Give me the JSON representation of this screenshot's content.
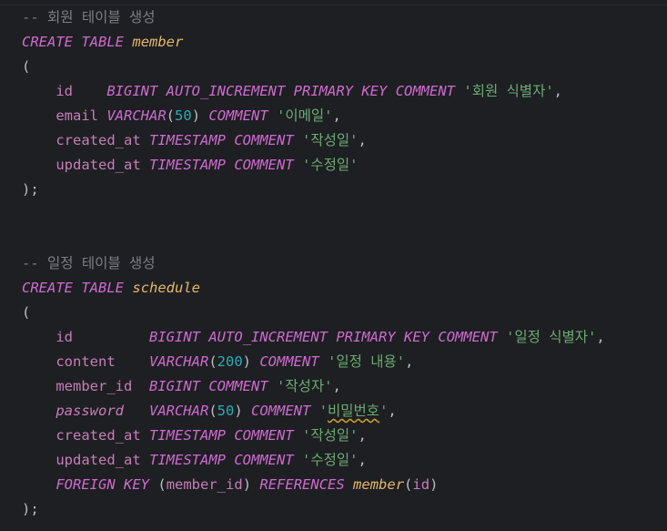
{
  "editor": {
    "lines": [
      [
        {
          "t": "-- 회원 테이블 생성",
          "c": "comment"
        }
      ],
      [
        {
          "t": "CREATE",
          "c": "kw"
        },
        {
          "t": " ",
          "c": "ws"
        },
        {
          "t": "TABLE",
          "c": "kw"
        },
        {
          "t": " ",
          "c": "ws"
        },
        {
          "t": "member",
          "c": "name"
        }
      ],
      [
        {
          "t": "(",
          "c": "paren"
        }
      ],
      [
        {
          "t": "    ",
          "c": "ws"
        },
        {
          "t": "id",
          "c": "field"
        },
        {
          "t": "    ",
          "c": "ws"
        },
        {
          "t": "BIGINT",
          "c": "kw"
        },
        {
          "t": " ",
          "c": "ws"
        },
        {
          "t": "AUTO_INCREMENT",
          "c": "kw"
        },
        {
          "t": " ",
          "c": "ws"
        },
        {
          "t": "PRIMARY",
          "c": "kw"
        },
        {
          "t": " ",
          "c": "ws"
        },
        {
          "t": "KEY",
          "c": "kw"
        },
        {
          "t": " ",
          "c": "ws"
        },
        {
          "t": "COMMENT",
          "c": "kw"
        },
        {
          "t": " ",
          "c": "ws"
        },
        {
          "t": "'회원 식별자'",
          "c": "str"
        },
        {
          "t": ",",
          "c": "punct"
        }
      ],
      [
        {
          "t": "    ",
          "c": "ws"
        },
        {
          "t": "email",
          "c": "field"
        },
        {
          "t": " ",
          "c": "ws"
        },
        {
          "t": "VARCHAR",
          "c": "kw"
        },
        {
          "t": "(",
          "c": "paren"
        },
        {
          "t": "50",
          "c": "num"
        },
        {
          "t": ")",
          "c": "paren"
        },
        {
          "t": " ",
          "c": "ws"
        },
        {
          "t": "COMMENT",
          "c": "kw"
        },
        {
          "t": " ",
          "c": "ws"
        },
        {
          "t": "'이메일'",
          "c": "str"
        },
        {
          "t": ",",
          "c": "punct"
        }
      ],
      [
        {
          "t": "    ",
          "c": "ws"
        },
        {
          "t": "created_at",
          "c": "field"
        },
        {
          "t": " ",
          "c": "ws"
        },
        {
          "t": "TIMESTAMP",
          "c": "kw"
        },
        {
          "t": " ",
          "c": "ws"
        },
        {
          "t": "COMMENT",
          "c": "kw"
        },
        {
          "t": " ",
          "c": "ws"
        },
        {
          "t": "'작성일'",
          "c": "str"
        },
        {
          "t": ",",
          "c": "punct"
        }
      ],
      [
        {
          "t": "    ",
          "c": "ws"
        },
        {
          "t": "updated_at",
          "c": "field"
        },
        {
          "t": " ",
          "c": "ws"
        },
        {
          "t": "TIMESTAMP",
          "c": "kw"
        },
        {
          "t": " ",
          "c": "ws"
        },
        {
          "t": "COMMENT",
          "c": "kw"
        },
        {
          "t": " ",
          "c": "ws"
        },
        {
          "t": "'수정일'",
          "c": "str"
        }
      ],
      [
        {
          "t": ");",
          "c": "punct"
        }
      ],
      [],
      [],
      [
        {
          "t": "-- 일정 테이블 생성",
          "c": "comment"
        }
      ],
      [
        {
          "t": "CREATE",
          "c": "kw"
        },
        {
          "t": " ",
          "c": "ws"
        },
        {
          "t": "TABLE",
          "c": "kw"
        },
        {
          "t": " ",
          "c": "ws"
        },
        {
          "t": "schedule",
          "c": "name"
        }
      ],
      [
        {
          "t": "(",
          "c": "paren"
        }
      ],
      [
        {
          "t": "    ",
          "c": "ws"
        },
        {
          "t": "id",
          "c": "field"
        },
        {
          "t": "         ",
          "c": "ws"
        },
        {
          "t": "BIGINT",
          "c": "kw"
        },
        {
          "t": " ",
          "c": "ws"
        },
        {
          "t": "AUTO_INCREMENT",
          "c": "kw"
        },
        {
          "t": " ",
          "c": "ws"
        },
        {
          "t": "PRIMARY",
          "c": "kw"
        },
        {
          "t": " ",
          "c": "ws"
        },
        {
          "t": "KEY",
          "c": "kw"
        },
        {
          "t": " ",
          "c": "ws"
        },
        {
          "t": "COMMENT",
          "c": "kw"
        },
        {
          "t": " ",
          "c": "ws"
        },
        {
          "t": "'일정 식별자'",
          "c": "str"
        },
        {
          "t": ",",
          "c": "punct"
        }
      ],
      [
        {
          "t": "    ",
          "c": "ws"
        },
        {
          "t": "content",
          "c": "field"
        },
        {
          "t": "    ",
          "c": "ws"
        },
        {
          "t": "VARCHAR",
          "c": "kw"
        },
        {
          "t": "(",
          "c": "paren"
        },
        {
          "t": "200",
          "c": "num"
        },
        {
          "t": ")",
          "c": "paren"
        },
        {
          "t": " ",
          "c": "ws"
        },
        {
          "t": "COMMENT",
          "c": "kw"
        },
        {
          "t": " ",
          "c": "ws"
        },
        {
          "t": "'일정 내용'",
          "c": "str"
        },
        {
          "t": ",",
          "c": "punct"
        }
      ],
      [
        {
          "t": "    ",
          "c": "ws"
        },
        {
          "t": "member_id",
          "c": "field"
        },
        {
          "t": "  ",
          "c": "ws"
        },
        {
          "t": "BIGINT",
          "c": "kw"
        },
        {
          "t": " ",
          "c": "ws"
        },
        {
          "t": "COMMENT",
          "c": "kw"
        },
        {
          "t": " ",
          "c": "ws"
        },
        {
          "t": "'작성자'",
          "c": "str"
        },
        {
          "t": ",",
          "c": "punct"
        }
      ],
      [
        {
          "t": "    ",
          "c": "ws"
        },
        {
          "t": "password",
          "c": "field-i"
        },
        {
          "t": "   ",
          "c": "ws"
        },
        {
          "t": "VARCHAR",
          "c": "kw"
        },
        {
          "t": "(",
          "c": "paren"
        },
        {
          "t": "50",
          "c": "num"
        },
        {
          "t": ")",
          "c": "paren"
        },
        {
          "t": " ",
          "c": "ws"
        },
        {
          "t": "COMMENT",
          "c": "kw"
        },
        {
          "t": " ",
          "c": "ws"
        },
        {
          "t": "'",
          "c": "str"
        },
        {
          "t": "비밀번호",
          "c": "str",
          "squiggle": true
        },
        {
          "t": "'",
          "c": "str"
        },
        {
          "t": ",",
          "c": "punct"
        }
      ],
      [
        {
          "t": "    ",
          "c": "ws"
        },
        {
          "t": "created_at",
          "c": "field"
        },
        {
          "t": " ",
          "c": "ws"
        },
        {
          "t": "TIMESTAMP",
          "c": "kw"
        },
        {
          "t": " ",
          "c": "ws"
        },
        {
          "t": "COMMENT",
          "c": "kw"
        },
        {
          "t": " ",
          "c": "ws"
        },
        {
          "t": "'작성일'",
          "c": "str"
        },
        {
          "t": ",",
          "c": "punct"
        }
      ],
      [
        {
          "t": "    ",
          "c": "ws"
        },
        {
          "t": "updated_at",
          "c": "field"
        },
        {
          "t": " ",
          "c": "ws"
        },
        {
          "t": "TIMESTAMP",
          "c": "kw"
        },
        {
          "t": " ",
          "c": "ws"
        },
        {
          "t": "COMMENT",
          "c": "kw"
        },
        {
          "t": " ",
          "c": "ws"
        },
        {
          "t": "'수정일'",
          "c": "str"
        },
        {
          "t": ",",
          "c": "punct"
        }
      ],
      [
        {
          "t": "    ",
          "c": "ws"
        },
        {
          "t": "FOREIGN",
          "c": "kw"
        },
        {
          "t": " ",
          "c": "ws"
        },
        {
          "t": "KEY",
          "c": "kw"
        },
        {
          "t": " ",
          "c": "ws"
        },
        {
          "t": "(",
          "c": "paren"
        },
        {
          "t": "member_id",
          "c": "field"
        },
        {
          "t": ")",
          "c": "paren"
        },
        {
          "t": " ",
          "c": "ws"
        },
        {
          "t": "REFERENCES",
          "c": "kw"
        },
        {
          "t": " ",
          "c": "ws"
        },
        {
          "t": "member",
          "c": "name"
        },
        {
          "t": "(",
          "c": "paren"
        },
        {
          "t": "id",
          "c": "field"
        },
        {
          "t": ")",
          "c": "paren"
        }
      ],
      [
        {
          "t": ");",
          "c": "punct"
        }
      ]
    ]
  }
}
